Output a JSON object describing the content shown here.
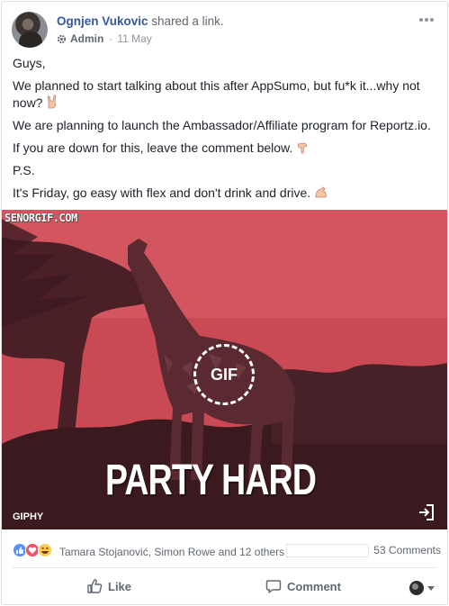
{
  "post": {
    "author": "Ognjen Vukovic",
    "action": "shared a link.",
    "role": "Admin",
    "date": "11 May",
    "lines": [
      "Guys,",
      "We planned to start talking about this after AppSumo, but fu*k it...why not now?",
      "We are planning to launch the Ambassador/Affiliate program for Reportz.io.",
      "If you are down for this, leave the comment below.",
      "P.S.",
      "It's Friday, go easy with flex and don't drink and drive."
    ]
  },
  "media": {
    "watermark": "SENORGIF.COM",
    "badge": "GIF",
    "caption": "PARTY HARD",
    "source": "GIPHY"
  },
  "stats": {
    "reactors": "Tamara Stojanović, Simon Rowe and 12 others",
    "comments": "53 Comments"
  },
  "actions": {
    "like": "Like",
    "comment": "Comment"
  },
  "icons": {
    "role": "gear-icon",
    "expand": "expand-icon",
    "reactions": [
      "like-reaction-icon",
      "love-reaction-icon",
      "haha-reaction-icon"
    ]
  },
  "colors": {
    "name": "#365899",
    "meta": "#90949c",
    "media_bg": "#c94a55",
    "like_blue": "#5890ff",
    "love_red": "#f25268"
  }
}
